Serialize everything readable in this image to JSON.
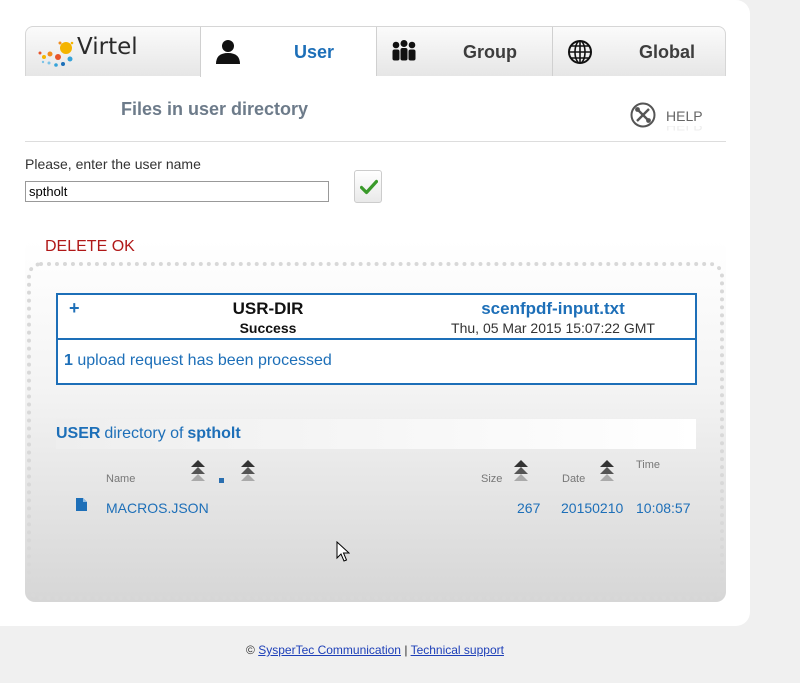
{
  "header": {
    "logo_text": "Virtel",
    "tabs": [
      {
        "label": "User",
        "icon": "user-icon",
        "active": true
      },
      {
        "label": "Group",
        "icon": "group-icon",
        "active": false
      },
      {
        "label": "Global",
        "icon": "globe-icon",
        "active": false
      }
    ]
  },
  "page": {
    "title": "Files in user directory",
    "help_label": "HELP"
  },
  "form": {
    "prompt": "Please, enter the user name",
    "user_value": "sptholt"
  },
  "status_message": "DELETE OK",
  "request": {
    "directory": "USR-DIR",
    "status": "Success",
    "filename": "scenfpdf-input.txt",
    "date": "Thu, 05 Mar 2015 15:07:22 GMT",
    "count": "1",
    "summary_text": "upload request has been processed"
  },
  "directory": {
    "title_prefix": "USER",
    "title_middle": "directory of",
    "title_user": "sptholt",
    "columns": {
      "name": "Name",
      "size": "Size",
      "date": "Date",
      "time": "Time"
    },
    "rows": [
      {
        "icon": "file-icon",
        "name": "MACROS.JSON",
        "size": "267",
        "date": "20150210",
        "time": "10:08:57"
      }
    ]
  },
  "footer": {
    "copyright": "©",
    "company_link": "SysperTec Communication",
    "separator": "|",
    "support_link": "Technical support"
  },
  "colors": {
    "accent": "#1d6fb8",
    "error": "#b01818"
  }
}
